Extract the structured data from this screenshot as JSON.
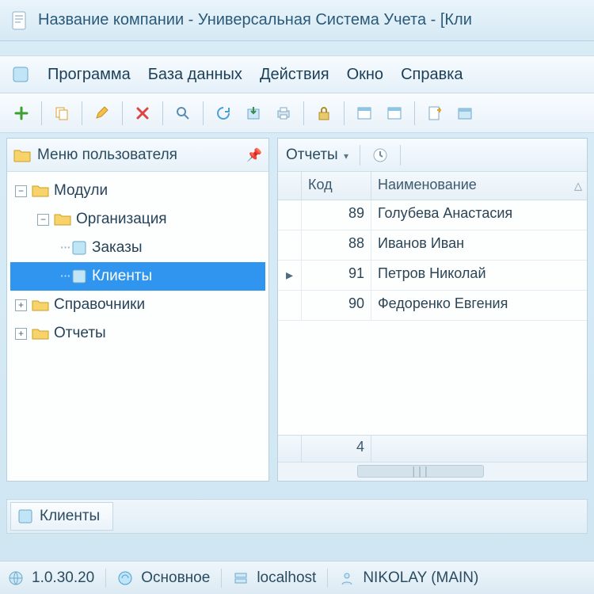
{
  "window": {
    "title": "Название компании - Универсальная Система Учета - [Кли"
  },
  "menu": {
    "items": [
      "Программа",
      "База данных",
      "Действия",
      "Окно",
      "Справка"
    ]
  },
  "sidebar": {
    "title": "Меню пользователя",
    "nodes": {
      "modules": "Модули",
      "organization": "Организация",
      "orders": "Заказы",
      "clients": "Клиенты",
      "refs": "Справочники",
      "reports": "Отчеты"
    }
  },
  "rightPanel": {
    "reportsBtn": "Отчеты",
    "columns": {
      "code": "Код",
      "name": "Наименование"
    },
    "rows": [
      {
        "code": "89",
        "name": "Голубева Анастасия"
      },
      {
        "code": "88",
        "name": "Иванов Иван"
      },
      {
        "code": "91",
        "name": "Петров Николай"
      },
      {
        "code": "90",
        "name": "Федоренко Евгения"
      }
    ],
    "footerCount": "4"
  },
  "tabs": {
    "active": "Клиенты"
  },
  "status": {
    "version": "1.0.30.20",
    "conn": "Основное",
    "host": "localhost",
    "user": "NIKOLAY (MAIN)"
  }
}
